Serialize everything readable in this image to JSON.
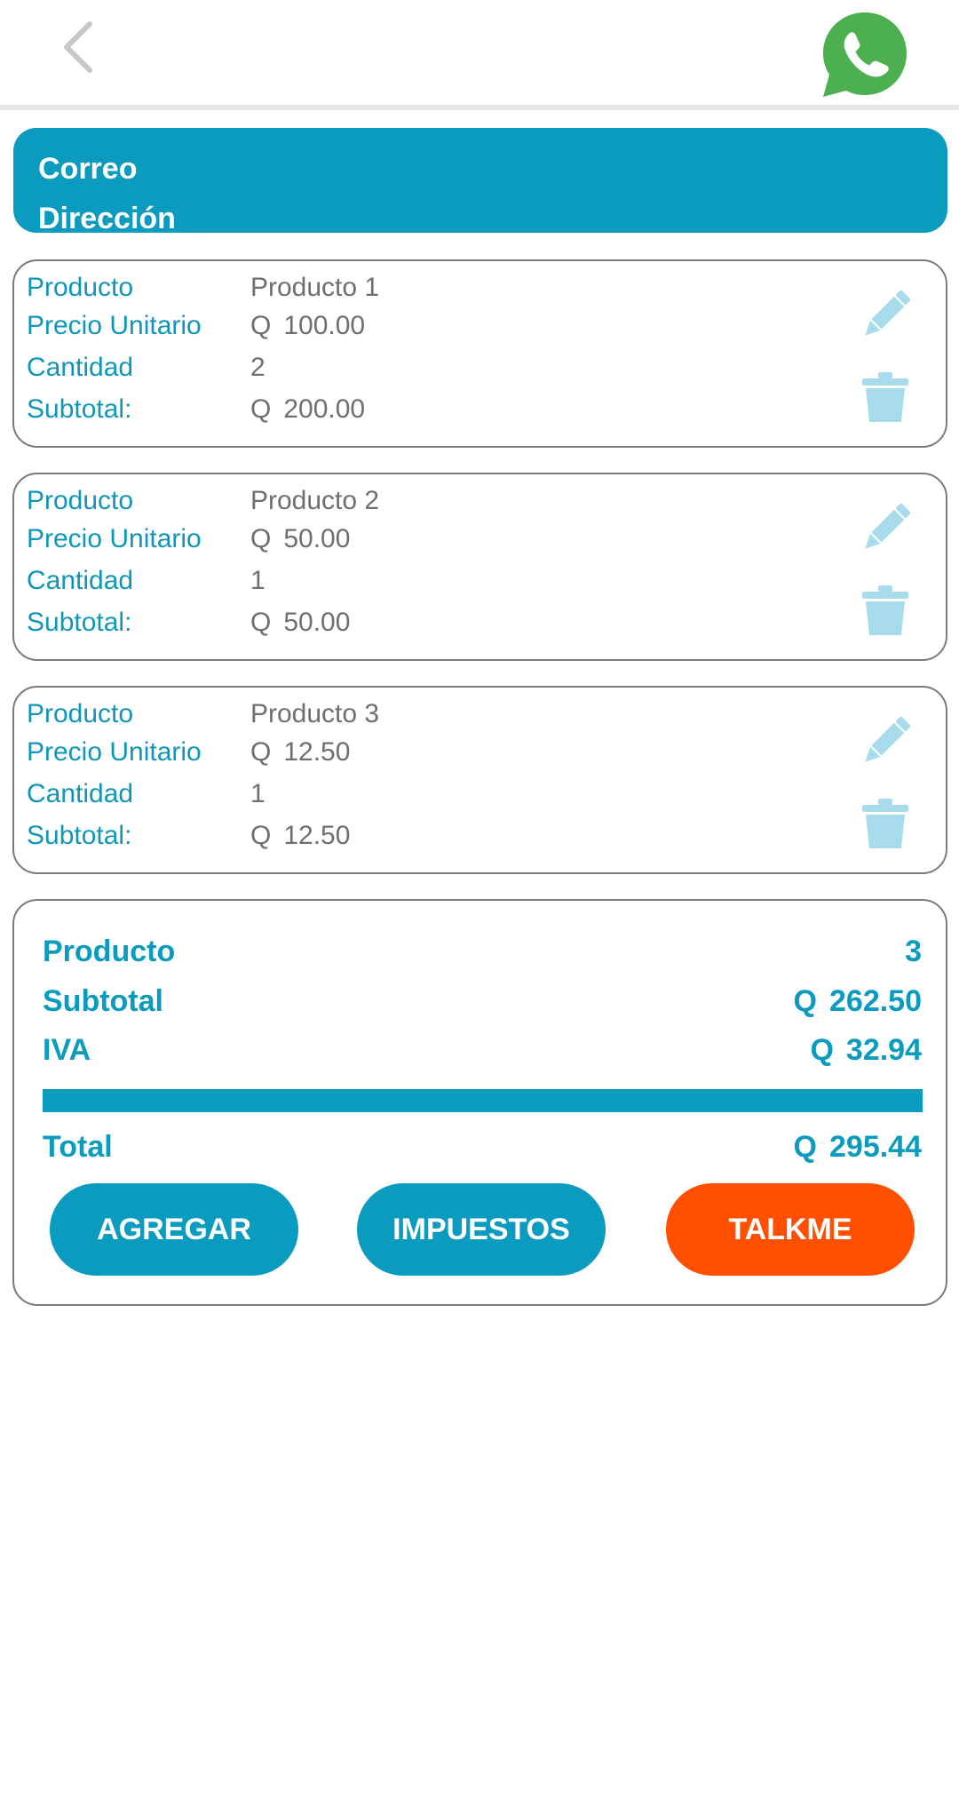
{
  "client": {
    "email_label": "Correo",
    "address_label": "Dirección"
  },
  "labels": {
    "product": "Producto",
    "unit_price": "Precio Unitario",
    "quantity": "Cantidad",
    "subtotal": "Subtotal:"
  },
  "currency": "Q",
  "products": [
    {
      "name": "Producto 1",
      "unit_price": "100.00",
      "quantity": "2",
      "subtotal": "200.00"
    },
    {
      "name": "Producto 2",
      "unit_price": "50.00",
      "quantity": "1",
      "subtotal": "50.00"
    },
    {
      "name": "Producto 3",
      "unit_price": "12.50",
      "quantity": "1",
      "subtotal": "12.50"
    }
  ],
  "summary": {
    "products_label": "Producto",
    "products_count": "3",
    "subtotal_label": "Subtotal",
    "subtotal_value": "262.50",
    "iva_label": "IVA",
    "iva_value": "32.94",
    "total_label": "Total",
    "total_value": "295.44"
  },
  "buttons": {
    "add": "AGREGAR",
    "taxes": "IMPUESTOS",
    "talkme": "TALKME"
  },
  "colors": {
    "primary": "#0b9bbf",
    "accent": "#ff4f00",
    "icon_light": "#a8dcec",
    "whatsapp": "#4caf50"
  },
  "icons": {
    "back": "chevron-left-icon",
    "whatsapp": "whatsapp-icon",
    "edit": "pencil-icon",
    "delete": "trash-icon"
  }
}
